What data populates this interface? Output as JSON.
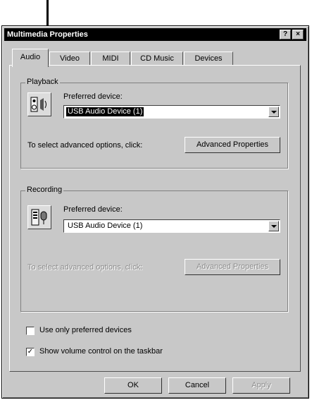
{
  "window": {
    "title": "Multimedia Properties",
    "help_glyph": "?",
    "close_glyph": "×"
  },
  "tabs": [
    {
      "label": "Audio"
    },
    {
      "label": "Video"
    },
    {
      "label": "MIDI"
    },
    {
      "label": "CD Music"
    },
    {
      "label": "Devices"
    }
  ],
  "playback": {
    "group_label": "Playback",
    "icon": "speaker-icon",
    "device_label": "Preferred device:",
    "device_value": "USB Audio Device (1)",
    "advanced_text": "To select advanced options, click:",
    "advanced_button": "Advanced Properties"
  },
  "recording": {
    "group_label": "Recording",
    "icon": "microphone-icon",
    "device_label": "Preferred device:",
    "device_value": "USB Audio Device (1)",
    "advanced_text": "To select advanced options, click:",
    "advanced_button": "Advanced Properties"
  },
  "options": {
    "preferred_only_label": "Use only preferred devices",
    "preferred_only_checked": false,
    "volume_label": "Show volume control on the taskbar",
    "volume_checked": true,
    "check_glyph": "✓"
  },
  "buttons": {
    "ok": "OK",
    "cancel": "Cancel",
    "apply": "Apply"
  }
}
